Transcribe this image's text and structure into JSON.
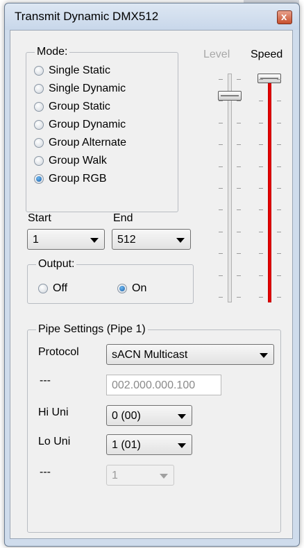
{
  "window": {
    "title": "Transmit Dynamic DMX512",
    "close_glyph": "x"
  },
  "mode": {
    "legend": "Mode:",
    "options": [
      {
        "label": "Single Static",
        "checked": false
      },
      {
        "label": "Single Dynamic",
        "checked": false
      },
      {
        "label": "Group Static",
        "checked": false
      },
      {
        "label": "Group Dynamic",
        "checked": false
      },
      {
        "label": "Group Alternate",
        "checked": false
      },
      {
        "label": "Group Walk",
        "checked": false
      },
      {
        "label": "Group RGB",
        "checked": true
      }
    ]
  },
  "range": {
    "start_label": "Start",
    "start_value": "1",
    "end_label": "End",
    "end_value": "512"
  },
  "output": {
    "legend": "Output:",
    "off_label": "Off",
    "on_label": "On",
    "selected": "On"
  },
  "sliders": {
    "level_label": "Level",
    "level_enabled": false,
    "level_value_fraction": 0.92,
    "speed_label": "Speed",
    "speed_value_fraction": 1.0
  },
  "pipe": {
    "legend": "Pipe Settings (Pipe 1)",
    "protocol_label": "Protocol",
    "protocol_value": "sACN Multicast",
    "address_label": "---",
    "address_value": "002.000.000.100",
    "hi_uni_label": "Hi Uni",
    "hi_uni_value": "0 (00)",
    "lo_uni_label": "Lo Uni",
    "lo_uni_value": "1 (01)",
    "extra_label": "---",
    "extra_value": "1"
  },
  "colors": {
    "speed_track": "#e60000",
    "radio_selected": "#1a5fa8",
    "window_frame": "#cfdcec"
  }
}
